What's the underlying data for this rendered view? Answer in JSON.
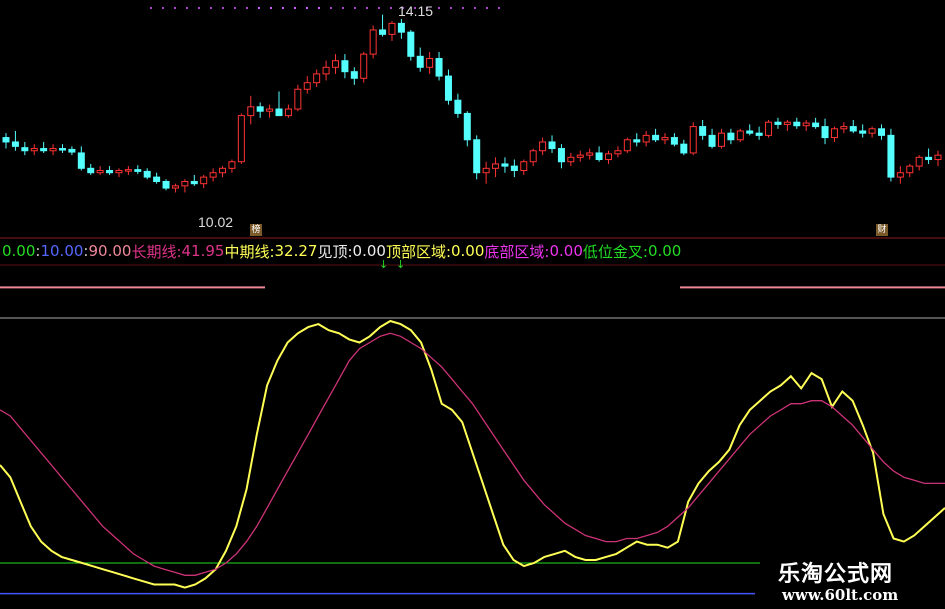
{
  "chart_data": [
    {
      "type": "candlestick",
      "panel": "price",
      "price_range": [
        9.2,
        14.3
      ],
      "high_label": "14.15",
      "low_label": "10.02",
      "up_color": "#ff3333",
      "down_color": "#54ffff",
      "candles": [
        [
          11.35,
          11.45,
          11.1,
          11.25
        ],
        [
          11.25,
          11.5,
          11.05,
          11.15
        ],
        [
          11.12,
          11.25,
          10.95,
          11.05
        ],
        [
          11.05,
          11.2,
          10.95,
          11.1
        ],
        [
          11.1,
          11.25,
          11.0,
          11.05
        ],
        [
          11.05,
          11.2,
          10.95,
          11.1
        ],
        [
          11.1,
          11.2,
          11.0,
          11.08
        ],
        [
          11.08,
          11.15,
          10.95,
          11.02
        ],
        [
          11.0,
          11.15,
          10.6,
          10.65
        ],
        [
          10.65,
          10.75,
          10.5,
          10.55
        ],
        [
          10.55,
          10.7,
          10.5,
          10.6
        ],
        [
          10.6,
          10.7,
          10.5,
          10.55
        ],
        [
          10.55,
          10.65,
          10.45,
          10.6
        ],
        [
          10.6,
          10.7,
          10.5,
          10.62
        ],
        [
          10.62,
          10.72,
          10.52,
          10.58
        ],
        [
          10.58,
          10.65,
          10.4,
          10.45
        ],
        [
          10.45,
          10.55,
          10.3,
          10.35
        ],
        [
          10.35,
          10.4,
          10.15,
          10.2
        ],
        [
          10.2,
          10.3,
          10.1,
          10.25
        ],
        [
          10.25,
          10.4,
          10.1,
          10.35
        ],
        [
          10.35,
          10.5,
          10.25,
          10.3
        ],
        [
          10.3,
          10.5,
          10.2,
          10.45
        ],
        [
          10.45,
          10.65,
          10.35,
          10.55
        ],
        [
          10.55,
          10.7,
          10.45,
          10.65
        ],
        [
          10.65,
          10.85,
          10.55,
          10.8
        ],
        [
          10.8,
          11.9,
          10.75,
          11.85
        ],
        [
          11.85,
          12.3,
          11.65,
          12.05
        ],
        [
          12.05,
          12.15,
          11.8,
          11.95
        ],
        [
          11.95,
          12.1,
          11.8,
          12.0
        ],
        [
          12.0,
          12.4,
          11.85,
          11.85
        ],
        [
          11.85,
          12.1,
          11.8,
          12.0
        ],
        [
          12.0,
          12.55,
          11.95,
          12.45
        ],
        [
          12.45,
          12.75,
          12.35,
          12.6
        ],
        [
          12.6,
          12.9,
          12.5,
          12.8
        ],
        [
          12.8,
          13.1,
          12.65,
          12.95
        ],
        [
          12.95,
          13.25,
          12.8,
          13.1
        ],
        [
          13.1,
          13.25,
          12.7,
          12.85
        ],
        [
          12.85,
          12.95,
          12.55,
          12.7
        ],
        [
          12.7,
          13.3,
          12.6,
          13.25
        ],
        [
          13.25,
          13.9,
          13.15,
          13.8
        ],
        [
          13.8,
          14.15,
          13.65,
          13.7
        ],
        [
          13.7,
          14.0,
          13.55,
          13.95
        ],
        [
          13.95,
          14.05,
          13.6,
          13.75
        ],
        [
          13.75,
          13.8,
          13.1,
          13.2
        ],
        [
          13.2,
          13.4,
          12.85,
          12.95
        ],
        [
          12.95,
          13.3,
          12.8,
          13.15
        ],
        [
          13.15,
          13.3,
          12.65,
          12.75
        ],
        [
          12.75,
          12.9,
          12.1,
          12.2
        ],
        [
          12.2,
          12.35,
          11.8,
          11.9
        ],
        [
          11.9,
          11.95,
          11.15,
          11.3
        ],
        [
          11.3,
          11.4,
          10.4,
          10.55
        ],
        [
          10.55,
          10.8,
          10.3,
          10.65
        ],
        [
          10.65,
          10.9,
          10.45,
          10.75
        ],
        [
          10.75,
          10.9,
          10.55,
          10.7
        ],
        [
          10.7,
          10.85,
          10.45,
          10.6
        ],
        [
          10.6,
          10.85,
          10.5,
          10.8
        ],
        [
          10.8,
          11.1,
          10.7,
          11.05
        ],
        [
          11.05,
          11.35,
          10.95,
          11.25
        ],
        [
          11.25,
          11.4,
          11.0,
          11.1
        ],
        [
          11.1,
          11.2,
          10.65,
          10.8
        ],
        [
          10.8,
          11.0,
          10.7,
          10.9
        ],
        [
          10.9,
          11.05,
          10.8,
          10.95
        ],
        [
          10.95,
          11.1,
          10.85,
          11.0
        ],
        [
          11.0,
          11.15,
          10.8,
          10.85
        ],
        [
          10.85,
          11.05,
          10.75,
          10.98
        ],
        [
          10.98,
          11.15,
          10.9,
          11.05
        ],
        [
          11.05,
          11.35,
          11.0,
          11.3
        ],
        [
          11.3,
          11.45,
          11.15,
          11.25
        ],
        [
          11.25,
          11.5,
          11.15,
          11.4
        ],
        [
          11.4,
          11.55,
          11.25,
          11.3
        ],
        [
          11.3,
          11.45,
          11.2,
          11.35
        ],
        [
          11.35,
          11.45,
          11.15,
          11.2
        ],
        [
          11.2,
          11.3,
          10.95,
          11.0
        ],
        [
          11.0,
          11.7,
          10.95,
          11.6
        ],
        [
          11.6,
          11.75,
          11.3,
          11.4
        ],
        [
          11.4,
          11.55,
          11.1,
          11.15
        ],
        [
          11.15,
          11.55,
          11.1,
          11.45
        ],
        [
          11.45,
          11.55,
          11.2,
          11.3
        ],
        [
          11.3,
          11.55,
          11.25,
          11.5
        ],
        [
          11.5,
          11.65,
          11.4,
          11.45
        ],
        [
          11.45,
          11.6,
          11.3,
          11.4
        ],
        [
          11.4,
          11.75,
          11.35,
          11.7
        ],
        [
          11.7,
          11.8,
          11.55,
          11.65
        ],
        [
          11.65,
          11.75,
          11.5,
          11.7
        ],
        [
          11.7,
          11.8,
          11.55,
          11.62
        ],
        [
          11.62,
          11.75,
          11.5,
          11.68
        ],
        [
          11.68,
          11.8,
          11.55,
          11.6
        ],
        [
          11.6,
          11.78,
          11.2,
          11.35
        ],
        [
          11.35,
          11.6,
          11.25,
          11.55
        ],
        [
          11.55,
          11.7,
          11.45,
          11.6
        ],
        [
          11.6,
          11.75,
          11.45,
          11.5
        ],
        [
          11.5,
          11.65,
          11.35,
          11.45
        ],
        [
          11.45,
          11.6,
          11.35,
          11.55
        ],
        [
          11.55,
          11.65,
          11.3,
          11.4
        ],
        [
          11.4,
          11.55,
          10.35,
          10.45
        ],
        [
          10.45,
          10.7,
          10.3,
          10.55
        ],
        [
          10.55,
          10.75,
          10.45,
          10.7
        ],
        [
          10.7,
          10.95,
          10.6,
          10.9
        ],
        [
          10.9,
          11.1,
          10.75,
          10.85
        ],
        [
          10.85,
          11.05,
          10.7,
          10.95
        ]
      ]
    },
    {
      "type": "line",
      "panel": "indicator",
      "ylim": [
        -5,
        105
      ],
      "series": [
        {
          "name": "中期线",
          "color": "#ffff55",
          "values": [
            42,
            38,
            30,
            22,
            17,
            14,
            12,
            11,
            10,
            9,
            8,
            7,
            6,
            5,
            4,
            3,
            3,
            3,
            2,
            3,
            5,
            8,
            14,
            22,
            34,
            52,
            68,
            76,
            82,
            85,
            87,
            88,
            86,
            85,
            83,
            82,
            84,
            87,
            89,
            88,
            86,
            82,
            73,
            62,
            60,
            56,
            46,
            36,
            26,
            16,
            11,
            9,
            10,
            12,
            13,
            14,
            12,
            11,
            11,
            12,
            13,
            15,
            17,
            16,
            16,
            15,
            17,
            30,
            36,
            40,
            43,
            47,
            55,
            60,
            63,
            66,
            68,
            71,
            67,
            72,
            70,
            61,
            66,
            63,
            55,
            46,
            26,
            18,
            17,
            19,
            22,
            25,
            28
          ]
        },
        {
          "name": "长期线",
          "color": "#cc3377",
          "values": [
            60,
            58,
            54,
            50,
            46,
            42,
            38,
            34,
            30,
            26,
            22,
            19,
            16,
            13,
            11,
            9,
            8,
            7,
            6,
            6,
            7,
            8,
            10,
            13,
            17,
            22,
            28,
            34,
            40,
            46,
            52,
            58,
            64,
            70,
            76,
            80,
            82,
            84,
            85,
            84,
            82,
            80,
            77,
            74,
            70,
            66,
            62,
            57,
            52,
            47,
            42,
            37,
            33,
            29,
            26,
            23,
            21,
            19,
            18,
            17,
            17,
            18,
            18,
            19,
            20,
            22,
            25,
            28,
            32,
            36,
            40,
            44,
            48,
            52,
            55,
            58,
            60,
            62,
            62,
            63,
            63,
            61,
            58,
            55,
            51,
            47,
            43,
            40,
            38,
            37,
            36,
            36,
            36
          ]
        }
      ],
      "reference_lines": [
        {
          "value": 100,
          "color": "#ee8899"
        },
        {
          "value": 90,
          "color": "#aaaaaa"
        },
        {
          "value": 10,
          "color": "#22dd22"
        },
        {
          "value": 0,
          "color": "#4455ff"
        }
      ]
    }
  ],
  "legend": [
    {
      "text": "0.00",
      "color": "#22dd22"
    },
    {
      "text": " : ",
      "color": "#cccccc"
    },
    {
      "text": "10.00",
      "color": "#5566ff"
    },
    {
      "text": " : ",
      "color": "#cccccc"
    },
    {
      "text": "90.00",
      "color": "#ee8899"
    },
    {
      "text": "  长期线: ",
      "color": "#dd3388"
    },
    {
      "text": "41.95",
      "color": "#dd3388"
    },
    {
      "text": "  中期线: ",
      "color": "#ffff55"
    },
    {
      "text": "32.27",
      "color": "#ffff55"
    },
    {
      "text": "  见顶: ",
      "color": "#eeeeee"
    },
    {
      "text": "0.00",
      "color": "#eeeeee"
    },
    {
      "text": "  顶部区域: ",
      "color": "#ffff55"
    },
    {
      "text": "0.00",
      "color": "#ffff55"
    },
    {
      "text": "  底部区域: ",
      "color": "#ee33ee"
    },
    {
      "text": "0.00",
      "color": "#ee33ee"
    },
    {
      "text": "  低位金叉: ",
      "color": "#22dd22"
    },
    {
      "text": "0.00",
      "color": "#22dd22"
    }
  ],
  "badges": {
    "left": "榜",
    "right": "财"
  },
  "watermark": {
    "title": "乐淘公式网",
    "url": "www.60lt.com"
  }
}
